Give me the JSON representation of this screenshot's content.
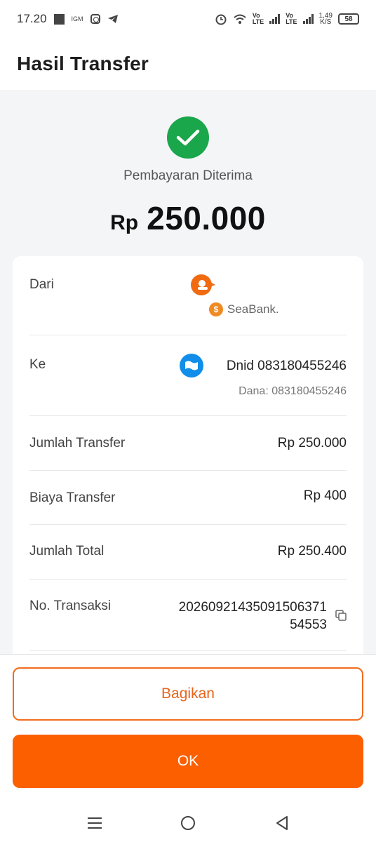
{
  "status_bar": {
    "time": "17.20",
    "notif_text": "IGM",
    "net1": [
      "Vo",
      "LTE"
    ],
    "net2": [
      "Vo",
      "LTE"
    ],
    "speed_value": "1,49",
    "speed_unit": "K/S",
    "battery": "58"
  },
  "header": {
    "title": "Hasil Transfer"
  },
  "success": {
    "status": "Pembayaran Diterima",
    "currency": "Rp",
    "amount": "250.000"
  },
  "details": {
    "from": {
      "label": "Dari",
      "bank": "SeaBank."
    },
    "to": {
      "label": "Ke",
      "name": "Dnid 083180455246",
      "sub": "Dana: 083180455246"
    },
    "amount": {
      "label": "Jumlah Transfer",
      "value": "Rp 250.000"
    },
    "fee": {
      "label": "Biaya Transfer",
      "value": "Rp 400"
    },
    "total": {
      "label": "Jumlah Total",
      "value": "Rp 250.400"
    },
    "transaction": {
      "label": "No. Transaksi",
      "line1": "20260921435091506371",
      "line2": "54553"
    }
  },
  "buttons": {
    "share": "Bagikan",
    "ok": "OK"
  },
  "colors": {
    "accent": "#fb5f00",
    "success": "#1aa64b",
    "dana": "#118ee9"
  }
}
